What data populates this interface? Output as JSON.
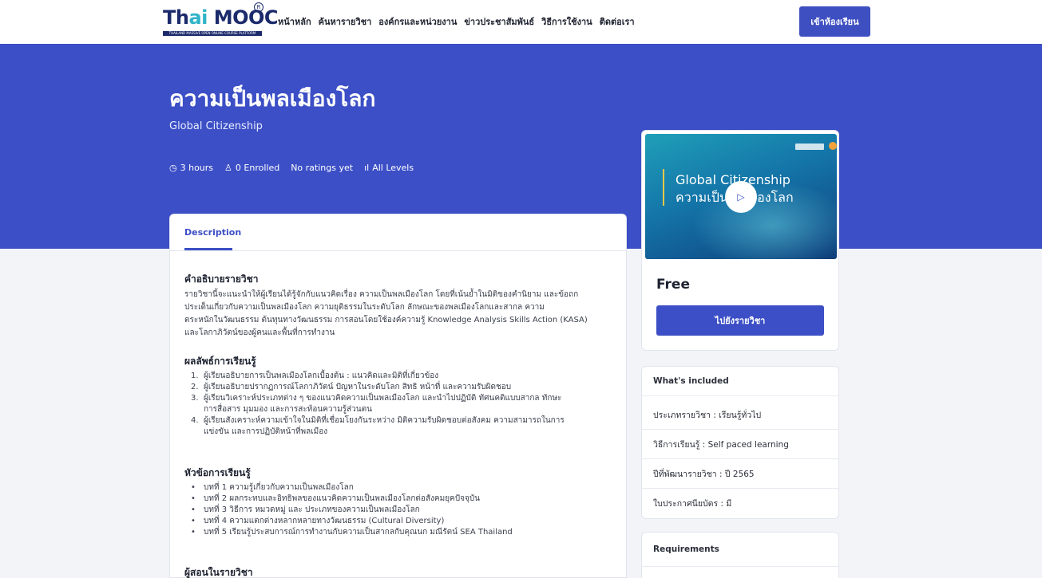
{
  "header": {
    "logo_text_a": "Th",
    "logo_text_b": "ai MOOC",
    "logo_tagline": "THAILAND MASSIVE OPEN ONLINE COURSE PLATFORM",
    "nav": [
      "หน้าหลัก",
      "ค้นหารายวิชา",
      "องค์กรและหน่วยงาน",
      "ข่าวประชาสัมพันธ์",
      "วิธีการใช้งาน",
      "ติดต่อเรา"
    ],
    "classroom_button": "เข้าห้องเรียน"
  },
  "hero": {
    "title": "ความเป็นพลเมืองโลก",
    "subtitle": "Global Citizenship",
    "meta": {
      "duration": "3 hours",
      "enrolled": "0 Enrolled",
      "ratings": "No ratings yet",
      "level": "All Levels"
    }
  },
  "tabs": {
    "description": "Description"
  },
  "description": {
    "heading": "คำอธิบายรายวิชา",
    "lines": [
      "รายวิชานี้จะแนะนำให้ผู้เรียนได้รู้จักกับแนวคิดเรื่อง ความเป็นพลเมืองโลก โดยที่เน้นย้ำในมิติของคำนิยาม และข้อถก",
      "ประเด็นเกี่ยวกับความเป็นพลเมืองโลก ความยุติธรรมในระดับโลก ลักษณะของพลเมืองโลกและสากล ความ",
      "ตระหนักในวัฒนธรรม ต้นทุนทางวัฒนธรรม การสอนโดยใช้องค์ความรู้ Knowledge Analysis Skills Action (KASA)",
      "และโลกาภิวัตน์ของผู้คนและพื้นที่การทำงาน"
    ]
  },
  "outcomes": {
    "heading": "ผลลัพธ์การเรียนรู้",
    "items": [
      {
        "num": "1.",
        "lines": [
          "ผู้เรียนอธิบายการเป็นพลเมืองโลกเบื้องต้น : แนวคิดและมิติที่เกี่ยวข้อง"
        ]
      },
      {
        "num": "2.",
        "lines": [
          "ผู้เรียนอธิบายปรากฏการณ์โลกาภิวัตน์ ปัญหาในระดับโลก สิทธิ หน้าที่ และความรับผิดชอบ"
        ]
      },
      {
        "num": "3.",
        "lines": [
          "ผู้เรียนวิเคราะห์ประเภทต่าง ๆ ของแนวคิดความเป็นพลเมืองโลก และนำไปปฏิบัติ ทัศนคติแบบสากล ทักษะ",
          "การสื่อสาร มุมมอง และการสะท้อนความรู้ส่วนตน"
        ]
      },
      {
        "num": "4.",
        "lines": [
          "ผู้เรียนสังเคราะห์ความเข้าใจในมิติที่เชื่อมโยงกันระหว่าง มิติความรับผิดชอบต่อสังคม ความสามารถในการ",
          "แข่งขัน และการปฏิบัติหน้าที่พลเมือง"
        ]
      }
    ]
  },
  "topics": {
    "heading": "หัวข้อการเรียนรู้",
    "items": [
      "บทที่ 1 ความรู้เกี่ยวกับความเป็นพลเมืองโลก",
      "บทที่ 2 ผลกระทบและอิทธิพลของแนวคิดความเป็นพลเมืองโลกต่อสังคมยุคปัจจุบัน",
      "บทที่ 3 วิธีการ หมวดหมู่ และ ประเภทของความเป็นพลเมืองโลก",
      "บทที่ 4 ความแตกต่างหลากหลายทางวัฒนธรรม (Cultural Diversity)",
      "บทที่ 5 เรียนรู้ประสบการณ์การทำงานกับความเป็นสากลกับคุณนก มณีรัตน์ SEA Thailand"
    ]
  },
  "instructors": {
    "heading": "ผู้สอนในรายวิชา"
  },
  "preview": {
    "thumb_line1": "Global Citizenship",
    "thumb_line2": "ความเป็นพลเมืองโลก",
    "price": "Free",
    "go_button": "ไปยังรายวิชา"
  },
  "included": {
    "heading": "What's included",
    "rows": [
      "ประเภทรายวิชา : เรียนรู้ทั่วไป",
      "วิธีการเรียนรู้ : Self paced learning",
      "ปีที่พัฒนารายวิชา : ปี 2565",
      "ใบประกาศนียบัตร : มี"
    ]
  },
  "requirements": {
    "heading": "Requirements"
  },
  "colors": {
    "brand": "#3c4fc6",
    "logo_navy": "#1b2a6b",
    "logo_teal": "#2fb4c8"
  },
  "icons": {
    "duration": "clock-icon",
    "enrolled": "user-icon",
    "level": "bar-chart-icon",
    "play": "play-icon"
  }
}
